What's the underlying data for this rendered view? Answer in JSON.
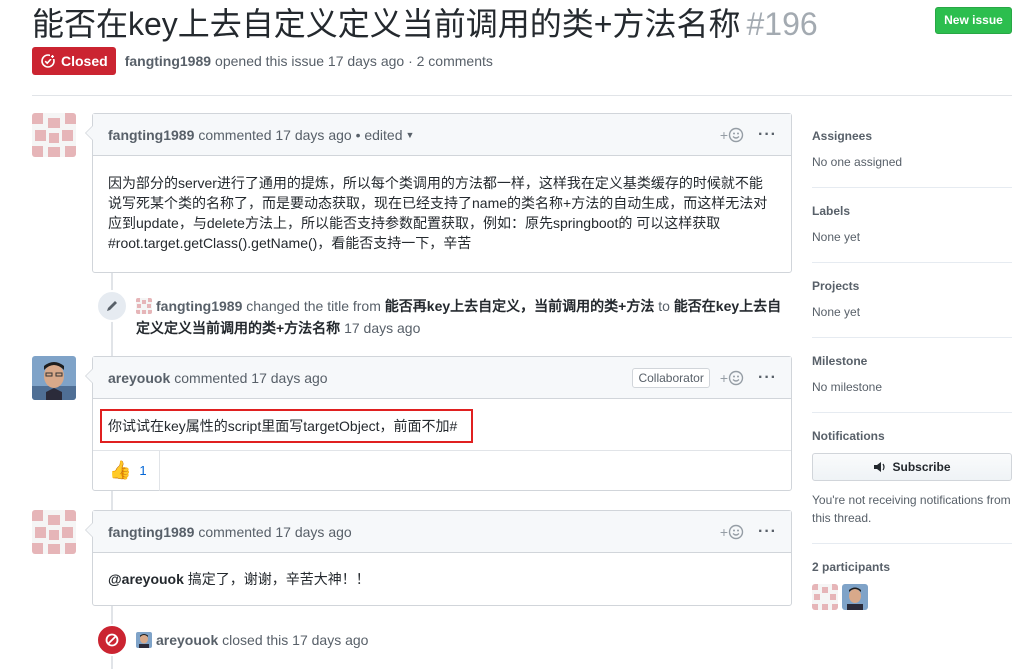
{
  "issue": {
    "title": "能否在key上去自定义定义当前调用的类+方法名称",
    "number": "#196",
    "state": "Closed",
    "author": "fangting1989",
    "opened_text": "opened this issue 17 days ago · 2 comments",
    "new_issue_label": "New issue"
  },
  "comments": [
    {
      "author": "fangting1989",
      "meta": "commented 17 days ago • edited",
      "body": "因为部分的server进行了通用的提炼，所以每个类调用的方法都一样，这样我在定义基类缓存的时候就不能说写死某个类的名称了，而是要动态获取，现在已经支持了name的类名称+方法的自动生成，而这样无法对应到update，与delete方法上，所以能否支持参数配置获取，例如：原先springboot的 可以这样获取#root.target.getClass().getName()，看能否支持一下，辛苦"
    },
    {
      "author": "areyouok",
      "meta": "commented 17 days ago",
      "badge": "Collaborator",
      "body": "你试试在key属性的script里面写targetObject，前面不加#",
      "reaction_count": "1"
    },
    {
      "author": "fangting1989",
      "meta": "commented 17 days ago",
      "mention": "@areyouok",
      "body": " 搞定了，谢谢，辛苦大神！！"
    }
  ],
  "events": {
    "rename": {
      "author": "fangting1989",
      "action": "changed the title from",
      "old_title": "能否再key上去自定义，当前调用的类+方法",
      "to": "to",
      "new_title": "能否在key上去自定义定义当前调用的类+方法名称",
      "time": "17 days ago"
    },
    "closed": {
      "author": "areyouok",
      "action": "closed this 17 days ago"
    }
  },
  "sidebar": {
    "assignees": {
      "heading": "Assignees",
      "value": "No one assigned"
    },
    "labels": {
      "heading": "Labels",
      "value": "None yet"
    },
    "projects": {
      "heading": "Projects",
      "value": "None yet"
    },
    "milestone": {
      "heading": "Milestone",
      "value": "No milestone"
    },
    "notifications": {
      "heading": "Notifications",
      "button": "Subscribe",
      "note": "You're not receiving notifications from this thread."
    },
    "participants": {
      "heading": "2 participants"
    }
  },
  "colors": {
    "closed_red": "#cb2431",
    "green": "#2cbe4e",
    "link_blue": "#0366d6",
    "highlight_red": "#e02020"
  }
}
